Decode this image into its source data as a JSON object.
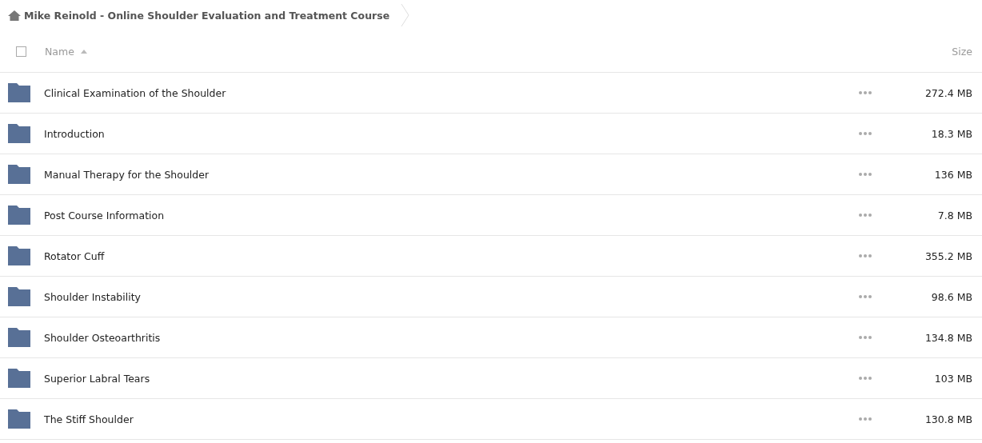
{
  "breadcrumb": {
    "title": "Mike Reinold - Online Shoulder Evaluation and Treatment Course"
  },
  "table": {
    "select_all": {
      "checked": false
    },
    "columns": [
      {
        "label": "Name",
        "sorted": true,
        "ascending": true
      },
      {
        "label": "Size"
      }
    ],
    "rows": [
      {
        "name": "Clinical Examination of the Shoulder",
        "size": "272.4 MB"
      },
      {
        "name": "Introduction",
        "size": "18.3 MB"
      },
      {
        "name": "Manual Therapy for the Shoulder",
        "size": "136 MB"
      },
      {
        "name": "Post Course Information",
        "size": "7.8 MB"
      },
      {
        "name": "Rotator Cuff",
        "size": "355.2 MB"
      },
      {
        "name": "Shoulder Instability",
        "size": "98.6 MB"
      },
      {
        "name": "Shoulder Osteoarthritis",
        "size": "134.8 MB"
      },
      {
        "name": "Superior Labral Tears",
        "size": "103 MB"
      },
      {
        "name": "The Stiff Shoulder",
        "size": "130.8 MB"
      }
    ]
  }
}
